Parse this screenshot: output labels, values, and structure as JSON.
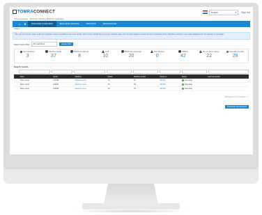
{
  "app": {
    "brand_prefix": "TOMRA",
    "brand_suffix": "CONNECT"
  },
  "header": {
    "language": "English",
    "language_chevron": "▾",
    "signout": "Sign out",
    "breadcrumb": "Tomra Connect  ›  Reverse Vending Machine Overview"
  },
  "nav": {
    "home_icon": "home-icon",
    "tabs": [
      "MACHINE OVERVIEW",
      "MACHINE GROUPS",
      "REPORTS",
      "BACKOFFICE"
    ]
  },
  "subnav": {
    "label": "Status"
  },
  "notice": {
    "text": "Here you can find the status of all your machines. Select a machine to see more details. Click on the machine ID to go to the machine page. Use the filters below to narrow the list of machines shown. Machines marked in red require attention from the operator or technician."
  },
  "filter": {
    "label": "Select store filter",
    "value": "All machines",
    "button": "Apply filter"
  },
  "stats": [
    {
      "label": "All machines",
      "value": "3",
      "icon": "pin-icon"
    },
    {
      "label": "Alarms (total)",
      "value": "37",
      "icon": "alarm-icon"
    },
    {
      "label": "Machine alarms",
      "value": "8",
      "icon": "warning-icon"
    },
    {
      "label": "Full",
      "value": "10",
      "icon": "full-icon"
    },
    {
      "label": "Machine warnings",
      "value": "20",
      "icon": "warn-circle-icon"
    },
    {
      "label": "Attendance",
      "value": "0",
      "icon": "attendance-icon"
    },
    {
      "label": "Offline",
      "value": "42",
      "icon": "offline-icon"
    },
    {
      "label": "No of users today",
      "value": "22",
      "icon": "user-icon"
    },
    {
      "label": "Operating today",
      "value": "29",
      "icon": "check-icon"
    }
  ],
  "search": {
    "label": "Search results"
  },
  "table": {
    "headers": [
      "",
      "Store",
      "Serial",
      "Machine",
      "Model",
      "Machine model",
      "Serial no",
      "Status",
      "Last transaction"
    ],
    "rows": [
      {
        "store": "Store name",
        "serial": "123456",
        "machine": "Machine name",
        "model": "T9",
        "mmodel": "T9",
        "serialno": "987654",
        "status": "Operating",
        "last": ""
      },
      {
        "store": "Store name",
        "serial": "123457",
        "machine": "Machine name",
        "model": "T9",
        "mmodel": "T9",
        "serialno": "987655",
        "status": "Operating",
        "last": ""
      },
      {
        "store": "Store name",
        "serial": "123458",
        "machine": "Machine name",
        "model": "T9",
        "mmodel": "T9",
        "serialno": "987656",
        "status": "Operating",
        "last": ""
      }
    ]
  },
  "pager": {
    "text": "Showing 1 to 3 of 3 entries  ‹ 1 ›"
  },
  "download": {
    "label": "Download report to Excel"
  }
}
